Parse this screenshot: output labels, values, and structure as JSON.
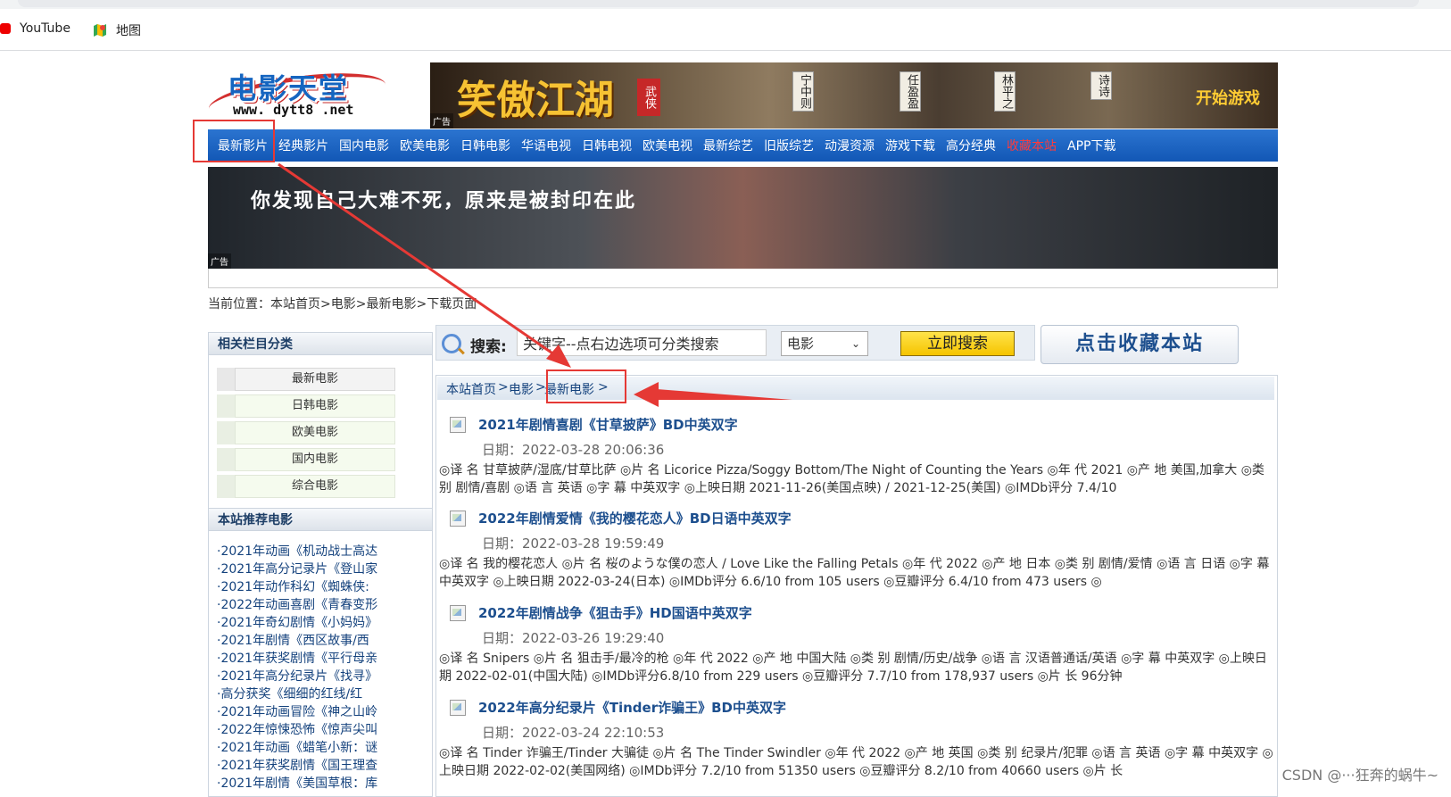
{
  "bookmarks": [
    {
      "label": "YouTube",
      "icon": "youtube-icon"
    },
    {
      "label": "地图",
      "icon": "maps-icon"
    }
  ],
  "logo": {
    "main": "电影天堂",
    "url": "www. dytt8 .net"
  },
  "top_ad": {
    "title": "笑傲江湖",
    "badge": "武侠",
    "names": [
      "宁中则",
      "任盈盈",
      "林平之",
      "诗诗"
    ],
    "play": "开始游戏",
    "tag": "广告"
  },
  "nav": {
    "items": [
      "最新影片",
      "经典影片",
      "国内电影",
      "欧美电影",
      "日韩电影",
      "华语电视",
      "日韩电视",
      "欧美电视",
      "最新综艺",
      "旧版综艺",
      "动漫资源",
      "游戏下载",
      "高分经典",
      "收藏本站",
      "APP下载"
    ]
  },
  "banner_ad": {
    "text": "你发现自己大难不死，原来是被封印在此",
    "tag": "广告"
  },
  "location": "当前位置：本站首页>电影>最新电影>下载页面",
  "sidebar": {
    "categories_title": "相关栏目分类",
    "categories": [
      "最新电影",
      "日韩电影",
      "欧美电影",
      "国内电影",
      "综合电影"
    ],
    "recommend_title": "本站推荐电影",
    "recommend": [
      "·2021年动画《机动战士高达",
      "·2021年高分记录片《登山家",
      "·2021年动作科幻《蜘蛛侠:",
      "·2022年动画喜剧《青春变形",
      "·2021年奇幻剧情《小妈妈》",
      "·2021年剧情《西区故事/西",
      "·2021年获奖剧情《平行母亲",
      "·2021年高分纪录片《找寻》",
      "·高分获奖《细细的红线/红",
      "·2021年动画冒险《神之山岭",
      "·2022年惊悚恐怖《惊声尖叫",
      "·2021年动画《蜡笔小新：谜",
      "·2021年获奖剧情《国王理查",
      "·2021年剧情《美国草根：库"
    ]
  },
  "search": {
    "label": "搜索:",
    "value": "关键字--点右边选项可分类搜索",
    "select": "电影",
    "button": "立即搜索"
  },
  "fav_button": "点击收藏本站",
  "breadcrumb": [
    "本站首页",
    ">",
    "电影",
    ">",
    "最新电影",
    ">"
  ],
  "entries": [
    {
      "title": "2021年剧情喜剧《甘草披萨》BD中英双字",
      "date": "日期：2022-03-28 20:06:36",
      "desc": "◎译 名 甘草披萨/湿底/甘草比萨 ◎片 名 Licorice Pizza/Soggy Bottom/The Night of Counting the Years ◎年 代 2021 ◎产 地 美国,加拿大 ◎类 别 剧情/喜剧 ◎语 言 英语 ◎字 幕 中英双字 ◎上映日期 2021-11-26(美国点映) / 2021-12-25(美国) ◎IMDb评分 7.4/10"
    },
    {
      "title": "2022年剧情爱情《我的樱花恋人》BD日语中英双字",
      "date": "日期：2022-03-28 19:59:49",
      "desc": "◎译 名 我的樱花恋人 ◎片 名 桜のような僕の恋人 / Love Like the Falling Petals ◎年 代 2022 ◎产 地 日本 ◎类 别 剧情/爱情 ◎语 言 日语 ◎字 幕 中英双字 ◎上映日期 2022-03-24(日本) ◎IMDb评分 6.6/10 from 105 users ◎豆瓣评分 6.4/10 from 473 users ◎"
    },
    {
      "title": "2022年剧情战争《狙击手》HD国语中英双字",
      "date": "日期：2022-03-26 19:29:40",
      "desc": "◎译 名 Snipers ◎片 名 狙击手/最冷的枪 ◎年 代 2022 ◎产 地 中国大陆 ◎类 别 剧情/历史/战争 ◎语 言 汉语普通话/英语 ◎字 幕 中英双字 ◎上映日期 2022-02-01(中国大陆) ◎IMDb评分6.8/10 from 229 users ◎豆瓣评分 7.7/10 from 178,937 users ◎片 长 96分钟"
    },
    {
      "title": "2022年高分纪录片《Tinder诈骗王》BD中英双字",
      "date": "日期：2022-03-24 22:10:53",
      "desc": "◎译 名 Tinder 诈骗王/Tinder 大骗徒 ◎片 名 The Tinder Swindler ◎年 代 2022 ◎产 地 英国 ◎类 别 纪录片/犯罪 ◎语 言 英语 ◎字 幕 中英双字 ◎上映日期 2022-02-02(美国网络) ◎IMDb评分 7.2/10 from 51350 users ◎豆瓣评分 8.2/10 from 40660 users ◎片 长"
    }
  ],
  "watermark": "CSDN @···狂奔的蜗牛~",
  "colors": {
    "nav_blue": "#1565c0",
    "highlight_red": "#e53935",
    "search_button": "#f5c400",
    "fav_nav": "#ff3b3b"
  }
}
